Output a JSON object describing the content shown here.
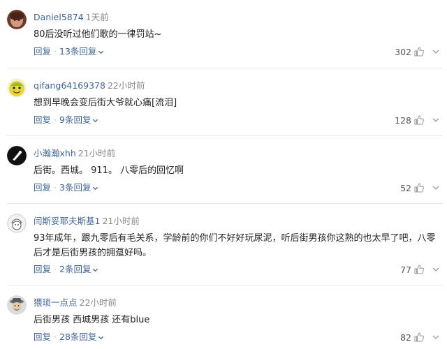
{
  "comments": [
    {
      "username": "Daniel5874",
      "time": "1天前",
      "content": "80后没听过他们歌的一律罚站~",
      "reply_label": "回复",
      "replies_label": "13条回复",
      "likes": "302",
      "avatar_icon": "user-avatar-icon"
    },
    {
      "username": "qifang64169378",
      "time": "22小时前",
      "content": "想到早晚会变后街大爷就心痛[流泪]",
      "reply_label": "回复",
      "replies_label": "9条回复",
      "likes": "128",
      "avatar_icon": "user-avatar-icon"
    },
    {
      "username": "小瀚瀚xhh",
      "time": "21小时前",
      "content": "后街。西城。 911。 八零后的回忆啊",
      "reply_label": "回复",
      "replies_label": "3条回复",
      "likes": "52",
      "avatar_icon": "user-avatar-icon"
    },
    {
      "username": "闫斯妥耶夫斯基1",
      "time": "21小时前",
      "content": "93年成年，跟九零后有毛关系，学龄前的你们不好好玩尿泥，听后街男孩你这熟的也太早了吧，八零后才是后街男孩的拥趸好吗。",
      "reply_label": "回复",
      "replies_label": "2条回复",
      "likes": "77",
      "avatar_icon": "user-avatar-icon"
    },
    {
      "username": "猥琐一点点",
      "time": "22小时前",
      "content": "后街男孩 西城男孩 还有blue",
      "reply_label": "回复",
      "replies_label": "28条回复",
      "likes": "82",
      "avatar_icon": "user-avatar-icon"
    }
  ],
  "colors": {
    "link": "#406599",
    "time": "#8a8a8a",
    "text": "#222222",
    "divider": "#e8e8e8"
  }
}
